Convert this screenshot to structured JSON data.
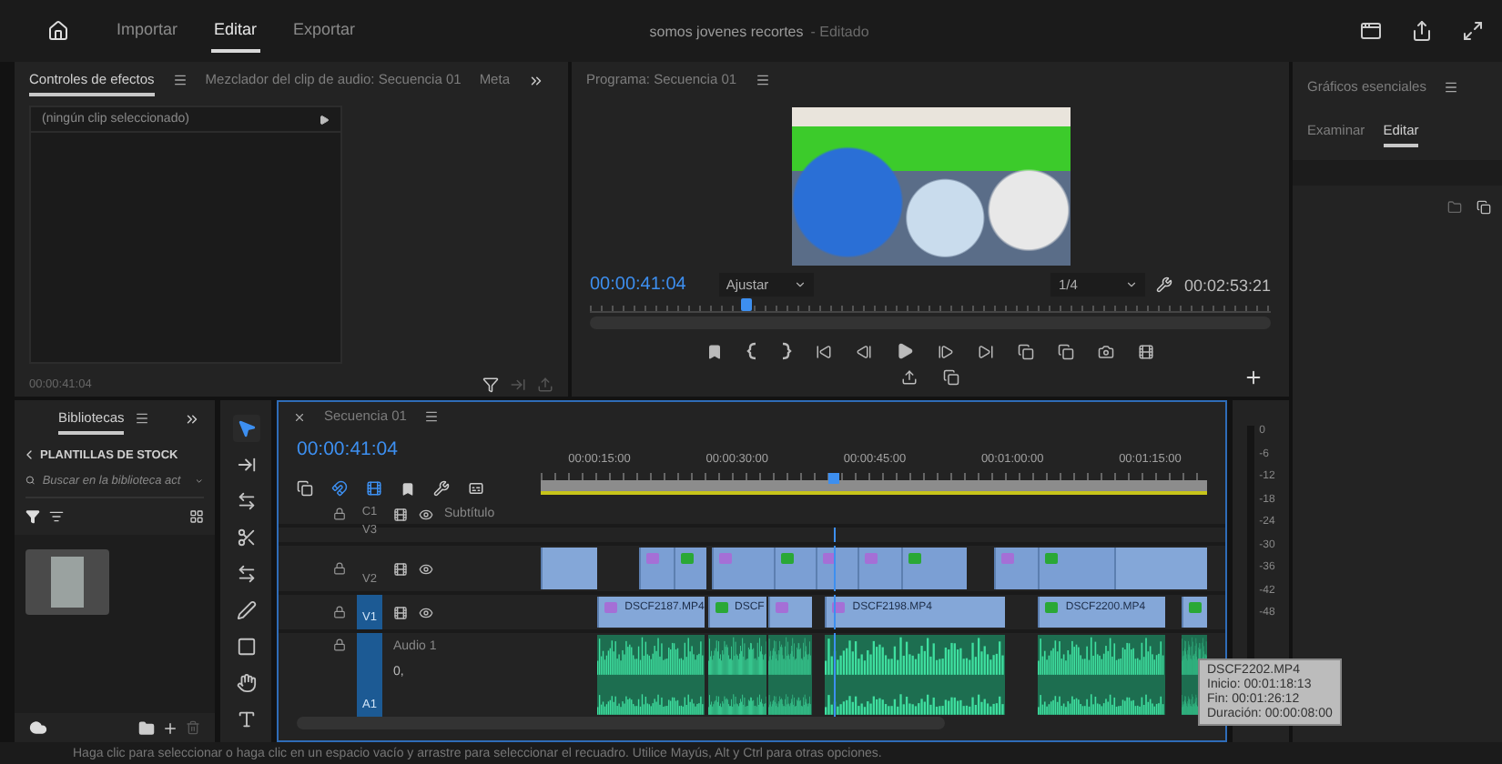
{
  "top_bar": {
    "tabs": [
      {
        "label": "Importar",
        "selected": false
      },
      {
        "label": "Editar",
        "selected": true
      },
      {
        "label": "Exportar",
        "selected": false
      }
    ],
    "title": "somos jovenes recortes",
    "title_status": "- Editado"
  },
  "effects_panel": {
    "tabs": [
      {
        "label": "Controles de efectos",
        "selected": true
      },
      {
        "label": "Mezclador del clip de audio: Secuencia 01",
        "selected": false
      },
      {
        "label": "Meta",
        "selected": false
      }
    ],
    "clip_header": "(ningún clip seleccionado)",
    "timecode": "00:00:41:04"
  },
  "program_monitor": {
    "title": "Programa: Secuencia 01",
    "timecode": "00:00:41:04",
    "fit": "Ajustar",
    "resolution": "1/4",
    "duration": "00:02:53:21",
    "playhead": {
      "level": 0.23
    }
  },
  "essential_graphics": {
    "title": "Gráficos esenciales",
    "tabs": [
      {
        "label": "Examinar",
        "selected": false
      },
      {
        "label": "Editar",
        "selected": true
      }
    ]
  },
  "libraries": {
    "tab": "Bibliotecas",
    "section": "PLANTILLAS DE STOCK",
    "search": {
      "placeholder": "Buscar en la biblioteca act"
    }
  },
  "tools": [
    {
      "kind": "selection",
      "selected": true
    },
    {
      "kind": "track-select",
      "selected": false
    },
    {
      "kind": "ripple",
      "selected": false
    },
    {
      "kind": "razor",
      "selected": false
    },
    {
      "kind": "slip",
      "selected": false
    },
    {
      "kind": "pen",
      "selected": false
    },
    {
      "kind": "rectangle",
      "selected": false
    },
    {
      "kind": "hand",
      "selected": false
    },
    {
      "kind": "type",
      "selected": false
    }
  ],
  "timeline": {
    "tab": "Secuencia 01",
    "timecode": "00:00:41:04",
    "ruler": [
      "00:00:15:00",
      "00:00:30:00",
      "00:00:45:00",
      "00:01:00:00",
      "00:01:15:00"
    ],
    "playhead": {
      "level": 0.44
    },
    "tracks": [
      {
        "kind": "caption",
        "name": "C1",
        "label": "Subtítulo",
        "targeted": false
      },
      {
        "kind": "video",
        "name": "V3",
        "targeted": false
      },
      {
        "kind": "video",
        "name": "V2",
        "targeted": false
      },
      {
        "kind": "video",
        "name": "V1",
        "targeted": true
      },
      {
        "kind": "audio",
        "name": "A1",
        "label": "Audio 1",
        "volume": "0,",
        "targeted": true
      }
    ],
    "v2_clips": [
      {
        "fx": false
      },
      {
        "fx": true,
        "color": "#a56fd6"
      },
      {
        "fx": true,
        "color": "#2aa836"
      },
      {
        "fx": true,
        "color": "#a56fd6"
      },
      {
        "fx": true,
        "color": "#2aa836"
      },
      {
        "fx": true,
        "color": "#a56fd6"
      },
      {
        "fx": true,
        "color": "#a56fd6"
      },
      {
        "fx": true,
        "color": "#2aa836"
      },
      {
        "fx": true,
        "color": "#a56fd6"
      },
      {
        "fx": true,
        "color": "#2aa836"
      },
      {
        "fx": false
      }
    ],
    "v1_clips": [
      {
        "label": "DSCF2187.MP4",
        "color": "#a56fd6"
      },
      {
        "label": "DSCF",
        "color": "#2aa836"
      },
      {
        "color": "#a56fd6"
      },
      {
        "label": "DSCF2198.MP4",
        "color": "#a56fd6"
      },
      {
        "label": "DSCF2200.MP4",
        "color": "#2aa836"
      },
      {
        "color": "#2aa836"
      }
    ],
    "tooltip": {
      "title": "DSCF2202.MP4",
      "lines": [
        "Inicio: 00:01:18:13",
        "Fin: 00:01:26:12",
        "Duración: 00:00:08:00"
      ]
    }
  },
  "audio_meter": {
    "scale": [
      "0",
      "-6",
      "-12",
      "-18",
      "-24",
      "-30",
      "-36",
      "-42",
      "-48"
    ]
  },
  "status_bar": "Haga clic para seleccionar o haga clic en un espacio vacío y arrastre para seleccionar el recuadro. Utilice Mayús, Alt y Ctrl para otras opciones."
}
